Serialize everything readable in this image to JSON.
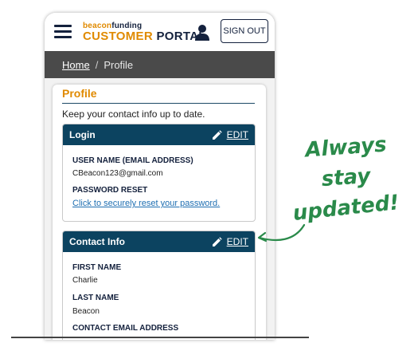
{
  "header": {
    "brand_prefix": "beacon",
    "brand_suffix": "funding",
    "portal_word1": "CUSTOMER",
    "portal_word2": "PORTAL",
    "sign_out_label": "SIGN OUT"
  },
  "breadcrumb": {
    "home": "Home",
    "separator": "/",
    "current": "Profile"
  },
  "profile": {
    "title": "Profile",
    "subtitle": "Keep your contact info up to date."
  },
  "login": {
    "title": "Login",
    "edit_label": "EDIT",
    "username_label": "USER NAME (EMAIL ADDRESS)",
    "username_value": "CBeacon123@gmail.com",
    "password_label": "PASSWORD RESET",
    "password_link": "Click to securely reset your password."
  },
  "contact": {
    "title": "Contact Info",
    "edit_label": "EDIT",
    "first_name_label": "FIRST NAME",
    "first_name_value": "Charlie",
    "last_name_label": "LAST NAME",
    "last_name_value": "Beacon",
    "email_label": "CONTACT EMAIL ADDRESS"
  },
  "annotation": {
    "line1": "Always",
    "line2": "stay",
    "line3": "updated!"
  },
  "colors": {
    "accent": "#e08a00",
    "navy": "#0c4360",
    "annotation": "#2a8a4a"
  }
}
